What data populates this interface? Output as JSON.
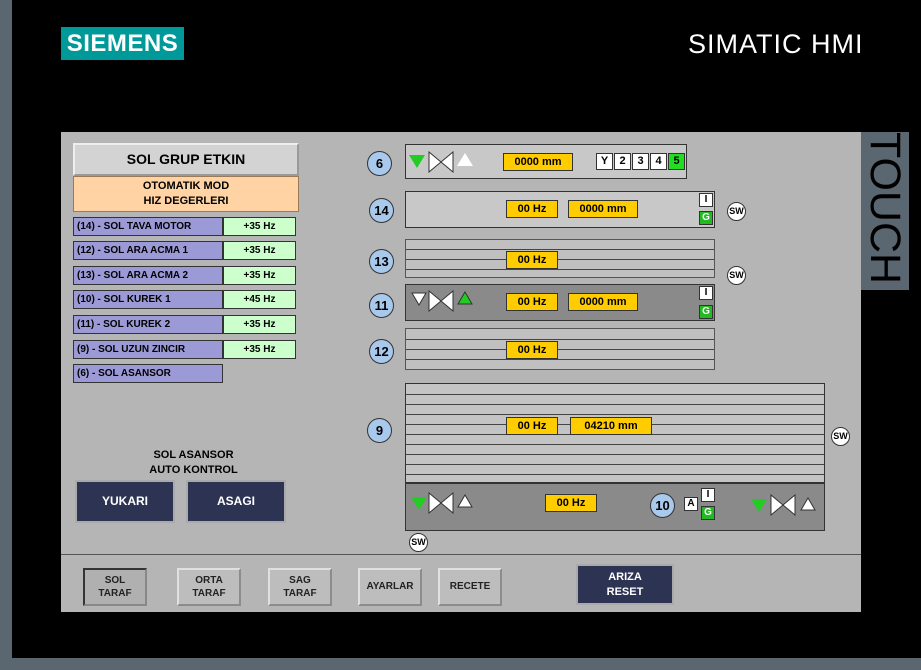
{
  "header": {
    "brand_logo": "SIEMENS",
    "product": "SIMATIC HMI",
    "touch": "TOUCH"
  },
  "left": {
    "title": "SOL GRUP ETKIN",
    "mode_line1": "OTOMATIK MOD",
    "mode_line2": "HIZ DEGERLERI",
    "motors": [
      {
        "label": "(14) - SOL TAVA MOTOR",
        "value": "+35 Hz"
      },
      {
        "label": "(12) - SOL ARA ACMA 1",
        "value": "+35 Hz"
      },
      {
        "label": "(13) - SOL ARA ACMA 2",
        "value": "+35 Hz"
      },
      {
        "label": "(10) - SOL KUREK 1",
        "value": "+45 Hz"
      },
      {
        "label": "(11) - SOL KUREK 2",
        "value": "+35 Hz"
      },
      {
        "label": "(9) - SOL UZUN ZINCIR",
        "value": "+35 Hz"
      },
      {
        "label": "(6) - SOL ASANSOR",
        "value": ""
      }
    ],
    "elevator_line1": "SOL ASANSOR",
    "elevator_line2": "AUTO KONTROL",
    "up_button": "YUKARI",
    "down_button": "ASAGI"
  },
  "conveyors": {
    "c6": {
      "num": "6",
      "pos": "0000 mm",
      "steps": [
        "Y",
        "2",
        "3",
        "4",
        "5"
      ],
      "active_step": "5"
    },
    "c14": {
      "num": "14",
      "hz": "00 Hz",
      "pos": "0000 mm",
      "i": "I",
      "g": "G",
      "sw": "SW"
    },
    "c13": {
      "num": "13",
      "hz": "00 Hz",
      "sw": "SW"
    },
    "c11": {
      "num": "11",
      "hz": "00 Hz",
      "pos": "0000 mm",
      "i": "I",
      "g": "G"
    },
    "c12": {
      "num": "12",
      "hz": "00 Hz"
    },
    "c9": {
      "num": "9",
      "hz": "00 Hz",
      "pos": "04210 mm",
      "sw": "SW"
    },
    "c10": {
      "num": "10",
      "hz": "00 Hz",
      "a": "A",
      "i": "I",
      "g": "G",
      "sw": "SW"
    }
  },
  "bottom": {
    "sol": {
      "l1": "SOL",
      "l2": "TARAF"
    },
    "orta": {
      "l1": "ORTA",
      "l2": "TARAF"
    },
    "sag": {
      "l1": "SAG",
      "l2": "TARAF"
    },
    "ayarlar": "AYARLAR",
    "recete": "RECETE",
    "ariza": {
      "l1": "ARIZA",
      "l2": "RESET"
    }
  }
}
